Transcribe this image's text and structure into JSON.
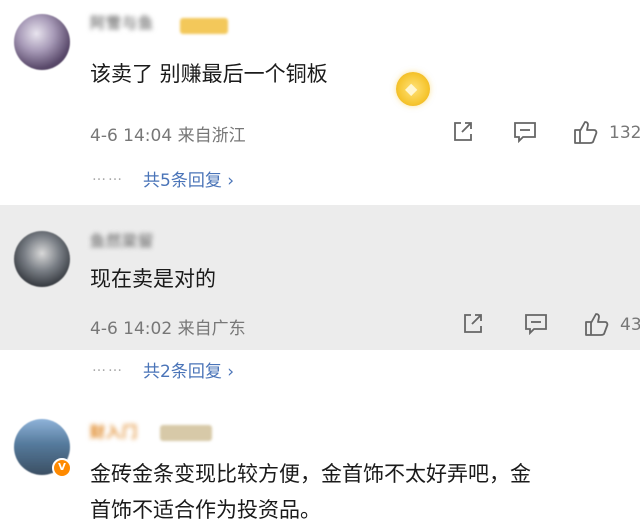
{
  "comments": [
    {
      "username": "阿雪与鱼",
      "text": "该卖了 别赚最后一个铜板",
      "time": "4-6 14:04",
      "location": "来自浙江",
      "likes": "132",
      "replies": "共5条回复",
      "chevron": "›"
    },
    {
      "username": "鱼然梁留",
      "text": "现在卖是对的",
      "time": "4-6 14:02",
      "location": "来自广东",
      "likes": "43",
      "replies": "共2条回复",
      "chevron": "›"
    },
    {
      "username": "财入门",
      "text_line1": "金砖金条变现比较方便，金首饰不太好弄吧，金",
      "text_line2": "首饰不适合作为投资品。"
    }
  ],
  "dots": "……",
  "icons": [
    "share-icon",
    "comment-icon",
    "like-icon",
    "gold-medal-icon",
    "verified-badge-icon"
  ],
  "colors": {
    "reply_link": "#4a74b8",
    "highlight_bg": "#ececec",
    "verified": "#ff8a00"
  }
}
